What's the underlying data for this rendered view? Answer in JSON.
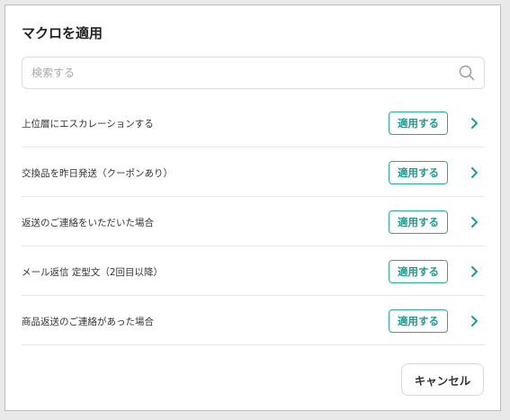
{
  "dialog": {
    "title": "マクロを適用",
    "search": {
      "placeholder": "検索する",
      "value": "",
      "icon": "search-icon"
    },
    "macros": [
      {
        "label": "上位層にエスカレーションする",
        "apply_label": "適用する"
      },
      {
        "label": "交換品を昨日発送（クーポンあり）",
        "apply_label": "適用する"
      },
      {
        "label": "返送のご連絡をいただいた場合",
        "apply_label": "適用する"
      },
      {
        "label": "メール返信 定型文（2回目以降）",
        "apply_label": "適用する"
      },
      {
        "label": "商品返送のご連絡があった場合",
        "apply_label": "適用する"
      }
    ],
    "cancel_label": "キャンセル",
    "colors": {
      "accent": "#1f9a93",
      "border": "#2aa8a0"
    }
  }
}
